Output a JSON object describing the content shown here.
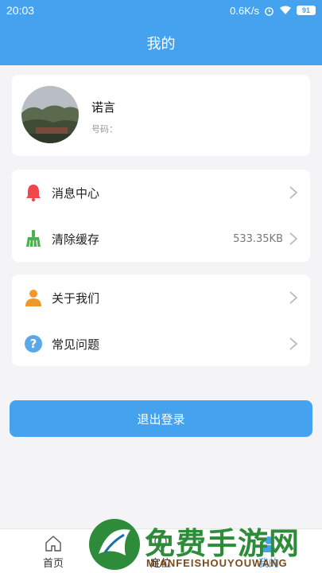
{
  "status_bar": {
    "time": "20:03",
    "speed": "0.6K/s",
    "battery": "91"
  },
  "header": {
    "title": "我的"
  },
  "profile": {
    "name": "诺言",
    "phone_label": "号码："
  },
  "menu_group_1": [
    {
      "label": "消息中心",
      "icon": "bell-icon",
      "value": ""
    },
    {
      "label": "清除缓存",
      "icon": "broom-icon",
      "value": "533.35KB"
    }
  ],
  "menu_group_2": [
    {
      "label": "关于我们",
      "icon": "person-icon",
      "value": ""
    },
    {
      "label": "常见问题",
      "icon": "question-icon",
      "value": ""
    }
  ],
  "logout_label": "退出登录",
  "tabs": [
    {
      "label": "首页",
      "icon": "home-icon"
    },
    {
      "label": "定位",
      "icon": "location-icon"
    },
    {
      "label": "我的",
      "icon": "profile-icon",
      "active": true
    }
  ],
  "watermark": {
    "title": "免费手游网",
    "subtitle": "MIANFEISHOUYOUWANG"
  },
  "colors": {
    "primary": "#45a2ee",
    "bell": "#f0474b",
    "broom": "#49b24d",
    "person": "#f0982a",
    "question": "#5aa8ea"
  }
}
